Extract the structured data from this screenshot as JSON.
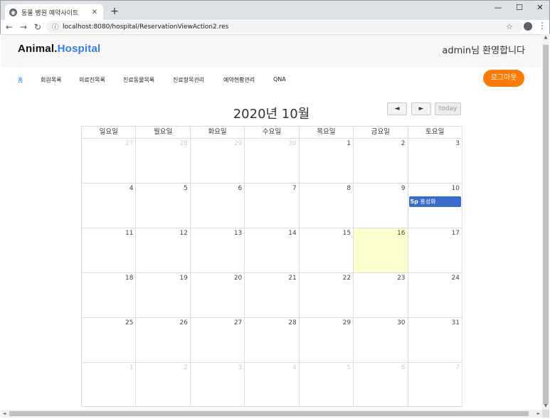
{
  "browser": {
    "tab_title": "동물 병원 예약사이트",
    "new_tab": "+",
    "url": "localhost:8080/hospital/ReservationViewAction2.res",
    "window_controls": [
      "—",
      "☐",
      "✕"
    ]
  },
  "header": {
    "logo_part1": "Animal.",
    "logo_part2": "Hospital",
    "welcome": "admin님 환영합니다"
  },
  "nav": {
    "items": [
      "홈",
      "회원목록",
      "의료진목록",
      "진료동물목록",
      "진료항목관리",
      "예약현황관리",
      "QNA"
    ],
    "logout": "로그아웃"
  },
  "calendar": {
    "title": "2020년 10월",
    "prev": "◄",
    "next": "►",
    "today": "today",
    "weekdays": [
      "일요일",
      "월요일",
      "화요일",
      "수요일",
      "목요일",
      "금요일",
      "토요일"
    ],
    "weeks": [
      [
        "27",
        "28",
        "29",
        "30",
        "1",
        "2",
        "3"
      ],
      [
        "4",
        "5",
        "6",
        "7",
        "8",
        "9",
        "10"
      ],
      [
        "11",
        "12",
        "13",
        "14",
        "15",
        "16",
        "17"
      ],
      [
        "18",
        "19",
        "20",
        "21",
        "22",
        "23",
        "24"
      ],
      [
        "25",
        "26",
        "27",
        "28",
        "29",
        "30",
        "31"
      ],
      [
        "1",
        "2",
        "3",
        "4",
        "5",
        "6",
        "7"
      ]
    ],
    "event": {
      "time": "5p",
      "name": "홍성화"
    }
  },
  "colors": {
    "accent": "#2f80ed",
    "logout": "#ff7a00",
    "event": "#3a6cd0",
    "today_bg": "#fcffcc"
  }
}
